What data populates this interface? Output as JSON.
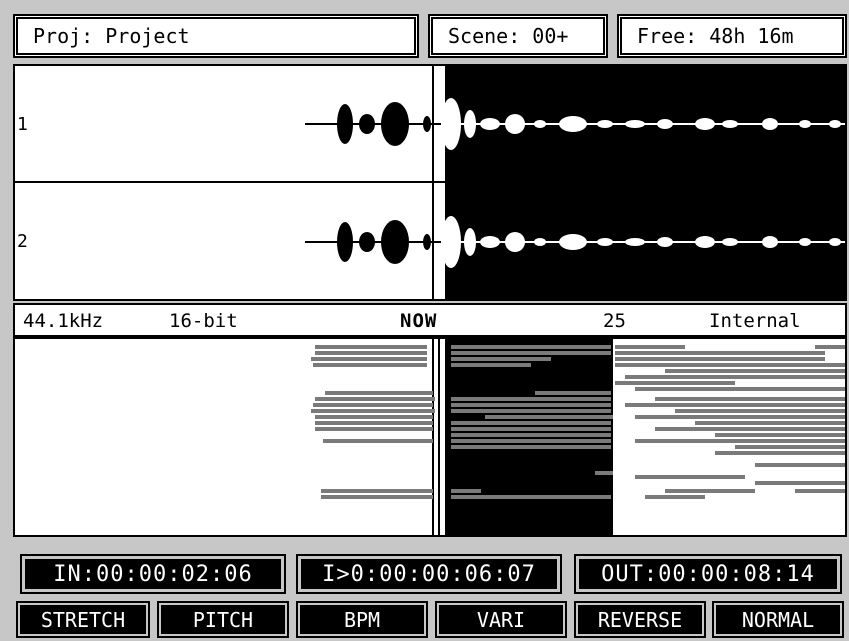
{
  "header": {
    "project": "Proj: Project",
    "scene": "Scene: 00+",
    "free": "Free: 48h 16m"
  },
  "tracks": [
    {
      "label": "1"
    },
    {
      "label": "2"
    }
  ],
  "status": {
    "sample_rate": "44.1kHz",
    "bit_depth": "16-bit",
    "now": "NOW",
    "frame_rate": "25",
    "sync": "Internal"
  },
  "timecodes": {
    "in": "IN:00:00:02:06",
    "current": "I>0:00:00:06:07",
    "out": "OUT:00:00:08:14"
  },
  "buttons": {
    "stretch": "STRETCH",
    "pitch": "PITCH",
    "bpm": "BPM",
    "vari": "VARI",
    "reverse": "REVERSE",
    "normal": "NORMAL"
  },
  "colors": {
    "background": "#c7c7c7",
    "display_bg": "#ffffff",
    "ink": "#000000",
    "overview_bar": "#7a7a7a"
  }
}
